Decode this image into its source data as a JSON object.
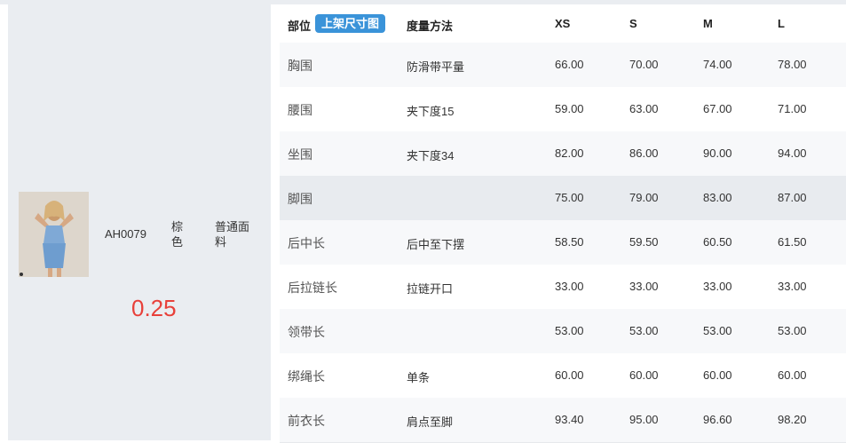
{
  "product": {
    "sku": "AH0079",
    "color": "棕色",
    "fabric": "普通面料",
    "ratio": "0.25",
    "photo_icon": "product-photo"
  },
  "table": {
    "headers": {
      "part": "部位",
      "tag": "上架尺寸图",
      "method": "度量方法",
      "xs": "XS",
      "s": "S",
      "m": "M",
      "l": "L"
    },
    "tag_color": "#3a93d9",
    "highlight_color": "#e8ebef",
    "rows": [
      {
        "part": "胸围",
        "method": "防滑带平量",
        "xs": "66.00",
        "s": "70.00",
        "m": "74.00",
        "l": "78.00"
      },
      {
        "part": "腰围",
        "method": "夹下度15",
        "xs": "59.00",
        "s": "63.00",
        "m": "67.00",
        "l": "71.00"
      },
      {
        "part": "坐围",
        "method": "夹下度34",
        "xs": "82.00",
        "s": "86.00",
        "m": "90.00",
        "l": "94.00"
      },
      {
        "part": "脚围",
        "method": "",
        "xs": "75.00",
        "s": "79.00",
        "m": "83.00",
        "l": "87.00"
      },
      {
        "part": "后中长",
        "method": "后中至下摆",
        "xs": "58.50",
        "s": "59.50",
        "m": "60.50",
        "l": "61.50"
      },
      {
        "part": "后拉链长",
        "method": "拉链开口",
        "xs": "33.00",
        "s": "33.00",
        "m": "33.00",
        "l": "33.00"
      },
      {
        "part": "领带长",
        "method": "",
        "xs": "53.00",
        "s": "53.00",
        "m": "53.00",
        "l": "53.00"
      },
      {
        "part": "绑绳长",
        "method": "单条",
        "xs": "60.00",
        "s": "60.00",
        "m": "60.00",
        "l": "60.00"
      },
      {
        "part": "前衣长",
        "method": "肩点至脚",
        "xs": "93.40",
        "s": "95.00",
        "m": "96.60",
        "l": "98.20"
      }
    ]
  }
}
